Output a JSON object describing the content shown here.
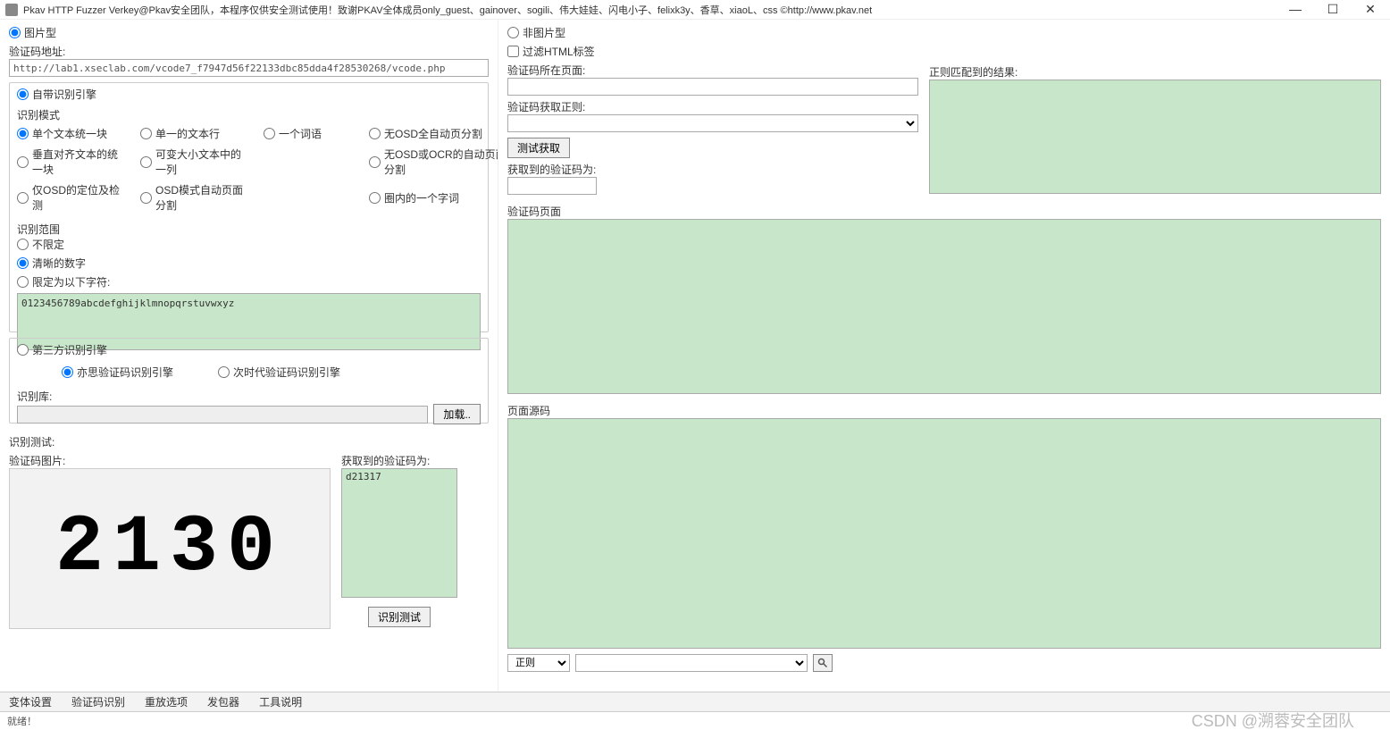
{
  "title": "Pkav HTTP Fuzzer   Verkey@Pkav安全团队，本程序仅供安全测试使用！致谢PKAV全体成员only_guest、gainover、sogili、伟大娃娃、闪电小子、felixk3y、香草、xiaoL、css  ©http://www.pkav.net",
  "left": {
    "image_type": "图片型",
    "addr_label": "验证码地址:",
    "addr_value": "http://lab1.xseclab.com/vcode7_f7947d56f22133dbc85dda4f28530268/vcode.php",
    "engine_builtin": "自带识别引擎",
    "mode_label": "识别模式",
    "modes": {
      "r1c1": "单个文本统一块",
      "r1c2": "单一的文本行",
      "r1c3": "一个词语",
      "r1c4": "无OSD全自动页分割",
      "r2c1": "垂直对齐文本的统一块",
      "r2c2": "可变大小文本中的一列",
      "r2c3": "",
      "r2c4": "无OSD或OCR的自动页面分割",
      "r3c1": "仅OSD的定位及检测",
      "r3c2": "OSD模式自动页面分割",
      "r3c4": "圈内的一个字词"
    },
    "range_label": "识别范围",
    "range_unlimited": "不限定",
    "range_clear_digits": "清晰的数字",
    "range_limit_chars": "限定为以下字符:",
    "range_chars_value": "0123456789abcdefghijklmnopqrstuvwxyz",
    "engine_third": "第三方识别引擎",
    "third_a": "亦思验证码识别引擎",
    "third_b": "次时代验证码识别引擎",
    "lib_label": "识别库:",
    "load_btn": "加载..",
    "test_label": "识别测试:",
    "captcha_img_label": "验证码图片:",
    "captcha_result_label": "获取到的验证码为:",
    "captcha_result_value": "d21317",
    "captcha_digits": "2130",
    "test_btn": "识别测试"
  },
  "right": {
    "non_image": "非图片型",
    "filter_html": "过滤HTML标签",
    "page_label": "验证码所在页面:",
    "regex_label": "验证码获取正则:",
    "test_extract_btn": "测试获取",
    "got_code_label": "获取到的验证码为:",
    "regex_result_label": "正则匹配到的结果:",
    "vcode_page_label": "验证码页面",
    "source_label": "页面源码",
    "regex_combo": "正则"
  },
  "tabs": [
    "变体设置",
    "验证码识别",
    "重放选项",
    "发包器",
    "工具说明"
  ],
  "status": "就绪！",
  "watermark": "CSDN @溯蓉安全团队"
}
